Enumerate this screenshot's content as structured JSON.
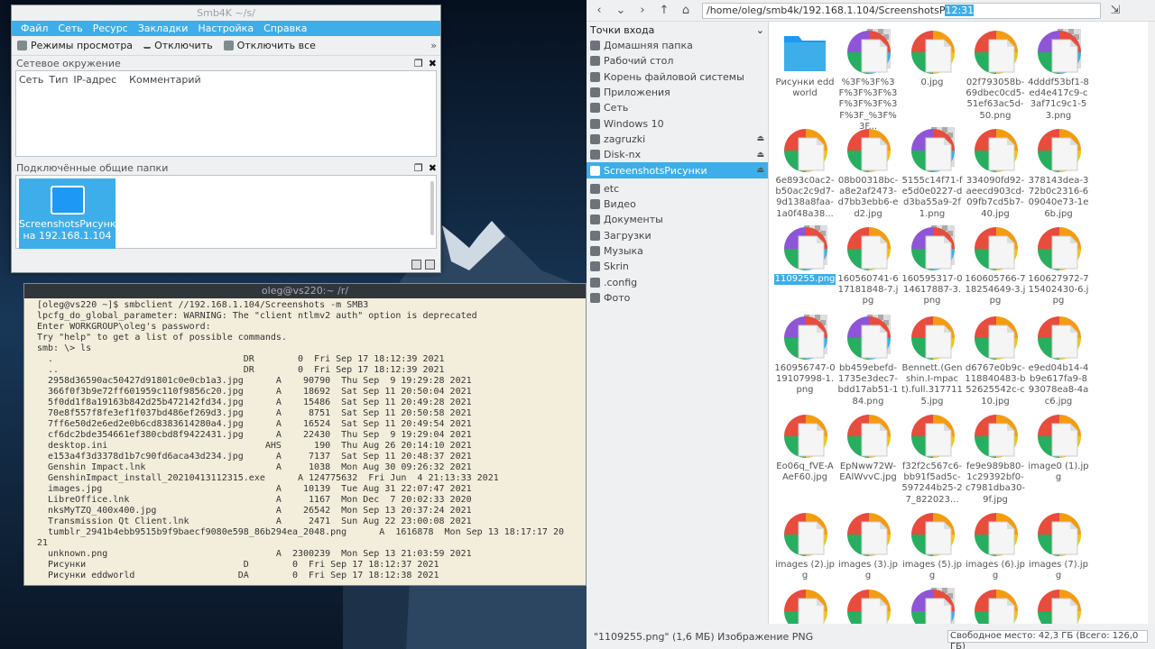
{
  "smb4k": {
    "title": "Smb4K  ~/s/",
    "menu": [
      "Файл",
      "Сеть",
      "Ресурс",
      "Закладки",
      "Настройка",
      "Справка"
    ],
    "toolbar": {
      "view_modes": "Режимы просмотра",
      "unmount": "Отключить",
      "unmount_all": "Отключить все",
      "more": "»"
    },
    "network_panel": {
      "title": "Сетевое окружение",
      "columns": [
        "Сеть",
        "Тип",
        "IP-адрес",
        "Комментарий"
      ]
    },
    "shares_panel": {
      "title": "Подключённые общие папки",
      "share_name": "ScreenshotsРисунки",
      "share_host": "на 192.168.1.104"
    }
  },
  "terminal": {
    "title": "oleg@vs220:~   /r/",
    "lines": [
      "[oleg@vs220 ~]$ smbclient //192.168.1.104/Screenshots -m SMB3",
      "lpcfg_do_global_parameter: WARNING: The \"client ntlmv2 auth\" option is deprecated",
      "Enter WORKGROUP\\oleg's password:",
      "Try \"help\" to get a list of possible commands.",
      "smb: \\> ls",
      "  .                                   DR        0  Fri Sep 17 18:12:39 2021",
      "  ..                                  DR        0  Fri Sep 17 18:12:39 2021",
      "  2958d36590ac50427d91801c0e0cb1a3.jpg      A    90790  Thu Sep  9 19:29:28 2021",
      "  366f0f3b9e72ff601959c110f9856c20.jpg      A    18692  Sat Sep 11 20:50:04 2021",
      "  5f0dd1f8a19163b842d25b472142fd34.jpg      A    15486  Sat Sep 11 20:49:28 2021",
      "  70e8f557f8fe3ef1f037bd486ef269d3.jpg      A     8751  Sat Sep 11 20:50:58 2021",
      "  7ff6e50d2e6ed2e0b6cd8383614280a4.jpg      A    16524  Sat Sep 11 20:49:54 2021",
      "  cf6dc2bde354661ef380cbd8f9422431.jpg      A    22430  Thu Sep  9 19:29:04 2021",
      "  desktop.ini                             AHS      190  Thu Aug 26 20:14:10 2021",
      "  e153a4f3d3378d1b7c90fd6aca43d234.jpg      A     7137  Sat Sep 11 20:48:37 2021",
      "  Genshin Impact.lnk                        A     1038  Mon Aug 30 09:26:32 2021",
      "  GenshinImpact_install_20210413112315.exe      A 124775632  Fri Jun  4 21:13:33 2021",
      "  images.jpg                                A    10139  Tue Aug 31 22:07:47 2021",
      "  LibreOffice.lnk                           A     1167  Mon Dec  7 20:02:33 2020",
      "  nksMyTZQ_400x400.jpg                      A    26542  Mon Sep 13 20:37:24 2021",
      "  Transmission Qt Client.lnk                A     2471  Sun Aug 22 23:00:08 2021",
      "  tumblr_2941b4ebb9515b9f9baecf9080e598_86b294ea_2048.png      A  1616878  Mon Sep 13 18:17:17 20",
      "21",
      "  unknown.png                               A  2300239  Mon Sep 13 21:03:59 2021",
      "  Рисунки                             D        0  Fri Sep 17 18:12:37 2021",
      "  Рисунки eddworld                   DA        0  Fri Sep 17 18:12:38 2021"
    ]
  },
  "filemanager": {
    "path_prefix": "/home/oleg/smb4k/192.168.1.104/ScreenshotsP",
    "path_selected": "12:31",
    "places_title": "Точки входа",
    "places": [
      {
        "label": "Домашняя папка",
        "icon": "home-icon",
        "eject": false
      },
      {
        "label": "Рабочий стол",
        "icon": "desktop-icon",
        "eject": false
      },
      {
        "label": "Корень файловой системы",
        "icon": "drive-icon",
        "eject": false
      },
      {
        "label": "Приложения",
        "icon": "apps-icon",
        "eject": false
      },
      {
        "label": "Сеть",
        "icon": "network-icon",
        "eject": false
      },
      {
        "label": "Windows 10",
        "icon": "windows-drive-icon",
        "eject": false
      },
      {
        "label": "zagruzki",
        "icon": "drive-icon",
        "eject": true
      },
      {
        "label": "Disk-nx",
        "icon": "drive-icon",
        "eject": true
      },
      {
        "label": "ScreenshotsРисунки",
        "icon": "network-share-icon",
        "eject": true,
        "active": true
      },
      {
        "label": "etc",
        "icon": "folder-icon",
        "eject": false
      },
      {
        "label": "Видео",
        "icon": "video-icon",
        "eject": false
      },
      {
        "label": "Документы",
        "icon": "documents-icon",
        "eject": false
      },
      {
        "label": "Загрузки",
        "icon": "downloads-icon",
        "eject": false
      },
      {
        "label": "Музыка",
        "icon": "music-icon",
        "eject": false
      },
      {
        "label": "Skrin",
        "icon": "folder-icon",
        "eject": false
      },
      {
        "label": ".config",
        "icon": "folder-icon",
        "eject": false
      },
      {
        "label": "Фото",
        "icon": "pictures-icon",
        "eject": false
      }
    ],
    "files": [
      {
        "name": "Рисунки eddworld",
        "type": "folder"
      },
      {
        "name": "%3F%3F%3F%3F%3F%3F%3F%3F%3F%3F_%3F%3F...",
        "type": "trans"
      },
      {
        "name": "0.jpg",
        "type": "img"
      },
      {
        "name": "02f793058b-69dbec0cd5-51ef63ac5d-50.png",
        "type": "img"
      },
      {
        "name": "4dddf53bf1-8ed4e417c9-c3af71c9c1-53.png",
        "type": "trans"
      },
      {
        "name": "6e893c0ac2-b50ac2c9d7-9d138a8faa-1a0f48a38...",
        "type": "img"
      },
      {
        "name": "08b00318bc-a8e2af2473-d7bb3ebb6-ed2.jpg",
        "type": "img"
      },
      {
        "name": "5155c14f71-fe5d0e0227-dd3ba55a9-2f1.png",
        "type": "trans"
      },
      {
        "name": "334090fd92-aeecd903cd-09fb7cd5b7-40.jpg",
        "type": "img"
      },
      {
        "name": "378143dea-372b0c2316-609040e73-1e6b.jpg",
        "type": "img"
      },
      {
        "name": "1109255.png",
        "type": "trans",
        "selected": true
      },
      {
        "name": "160560741-617181848-7.jpg",
        "type": "img"
      },
      {
        "name": "160595317-014617887-3.png",
        "type": "trans"
      },
      {
        "name": "160605766-718254649-3.jpg",
        "type": "img"
      },
      {
        "name": "160627972-715402430-6.jpg",
        "type": "img"
      },
      {
        "name": "160956747-019107998-1.png",
        "type": "trans"
      },
      {
        "name": "bb459ebefd-1735e3dec7-bdd17ab51-184.png",
        "type": "trans"
      },
      {
        "name": "Bennett.(Genshin.I-mpact).full.3177115.jpg",
        "type": "img"
      },
      {
        "name": "d6767e0b9c-118840483-b52625542c-c10.jpg",
        "type": "img"
      },
      {
        "name": "e9ed04b14-4b9e617fa9-893078ea8-4ac6.jpg",
        "type": "img"
      },
      {
        "name": "Eo06q_fVE-AAeF60.jpg",
        "type": "img"
      },
      {
        "name": "EpNww72W-EAIWvvC.jpg",
        "type": "img"
      },
      {
        "name": "f32f2c567c6-bb91f5ad5c-597244b25-27_822023...",
        "type": "img"
      },
      {
        "name": "fe9e989b80-1c29392bf0-c7981dba30-9f.jpg",
        "type": "img"
      },
      {
        "name": "image0 (1).jpg",
        "type": "img"
      },
      {
        "name": "images (2).jpg",
        "type": "img"
      },
      {
        "name": "images (3).jpg",
        "type": "img"
      },
      {
        "name": "images (5).jpg",
        "type": "img"
      },
      {
        "name": "images (6).jpg",
        "type": "img"
      },
      {
        "name": "images (7).jpg",
        "type": "img"
      },
      {
        "name": "",
        "type": "img"
      },
      {
        "name": "",
        "type": "img"
      },
      {
        "name": "",
        "type": "trans"
      },
      {
        "name": "",
        "type": "img"
      },
      {
        "name": "",
        "type": "img"
      }
    ],
    "status_text": "\"1109255.png\" (1,6 МБ) Изображение PNG",
    "free_space": "Свободное место: 42,3 ГБ (Всего: 126,0 ГБ)"
  },
  "colors": {
    "accent": "#3daee9",
    "window_bg": "#eff0f1",
    "terminal_bg": "#f3eedc",
    "folder": "#1d99f3"
  }
}
